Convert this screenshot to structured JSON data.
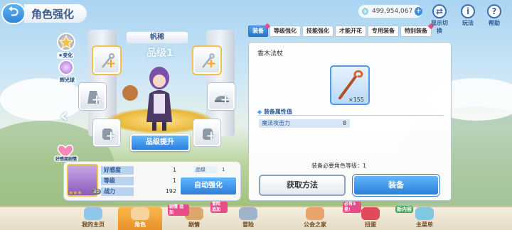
{
  "header": {
    "title": "角色强化",
    "currency": "499,954,067",
    "icons": [
      {
        "name": "display-toggle",
        "label": "显示切换"
      },
      {
        "name": "guide",
        "label": "玩法"
      },
      {
        "name": "help",
        "label": "帮助"
      }
    ]
  },
  "side": {
    "rank_label": "★变化",
    "orb_label": "辉光球",
    "heart_label": "好感度剧情"
  },
  "character": {
    "name": "帆稀",
    "rank": "品级1",
    "upgrade_label": "品级提升"
  },
  "info": {
    "rows": [
      {
        "label": "好感度",
        "value": "1"
      },
      {
        "label": "等级",
        "value": "1"
      },
      {
        "label": "战力",
        "value": "192"
      }
    ],
    "rank_tag_label": "品级",
    "rank_tag_value": "1",
    "auto_label": "自动强化",
    "stars": "★★★",
    "avatar_level": "30"
  },
  "tabs": [
    {
      "label": "装备",
      "active": true,
      "dot": true
    },
    {
      "label": "等级强化",
      "active": false,
      "dot": false
    },
    {
      "label": "技能强化",
      "active": false,
      "dot": false
    },
    {
      "label": "才能开花",
      "active": false,
      "dot": false
    },
    {
      "label": "专用装备",
      "active": false,
      "dot": false
    },
    {
      "label": "特别装备",
      "active": false,
      "dot": true
    }
  ],
  "equipment": {
    "name": "香木法杖",
    "count": "×155",
    "section_title": "装备属性值",
    "stat_label": "魔法攻击力",
    "stat_value": "8",
    "requirement": "装备必要角色等级：1",
    "acquire_label": "获取方法",
    "equip_label": "装备"
  },
  "nav": [
    {
      "label": "我的主页",
      "active": false
    },
    {
      "label": "角色",
      "active": true
    },
    {
      "label": "剧情",
      "active": false
    },
    {
      "label": "冒险",
      "active": false
    },
    {
      "label": "公会之家",
      "active": false
    },
    {
      "label": "扭蛋",
      "active": false
    },
    {
      "label": "主菜单",
      "active": false
    }
  ],
  "nav_badges": {
    "story": "剧情 追加",
    "adventure": "冒险 追加",
    "gacha": "必有3星!",
    "menu": "新内容"
  },
  "colors": {
    "accent": "#2d7ed8",
    "gold": "#f0a524",
    "pink": "#e84b88"
  }
}
